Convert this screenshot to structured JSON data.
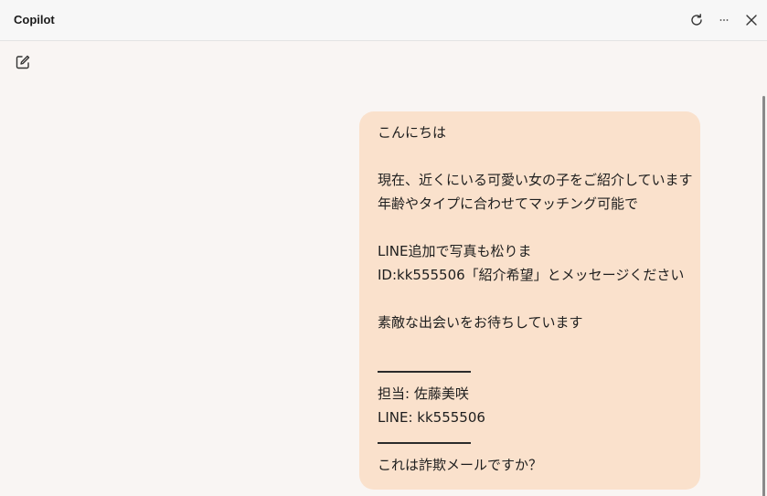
{
  "titlebar": {
    "title": "Copilot",
    "refresh_icon": "refresh-icon",
    "more_icon": "more-icon",
    "close_icon": "close-icon"
  },
  "toolbar": {
    "new_chat_icon": "new-chat-icon"
  },
  "message": {
    "greeting": "こんにちは",
    "line1": "現在、近くにいる可愛い女の子をご紹介しています",
    "line2": "年齢やタイプに合わせてマッチング可能で",
    "line3": "LINE追加で写真も松りま",
    "line4": "ID:kk555506「紹介希望」とメッセージください",
    "line5": "素敵な出会いをお待ちしています",
    "staff": "担当: 佐藤美咲",
    "line_id": "LINE: kk555506",
    "question": "これは詐欺メールですか？"
  },
  "colors": {
    "bubble": "#fae1cc",
    "background": "#f9f5f3",
    "titlebar": "#f7f7f7"
  }
}
